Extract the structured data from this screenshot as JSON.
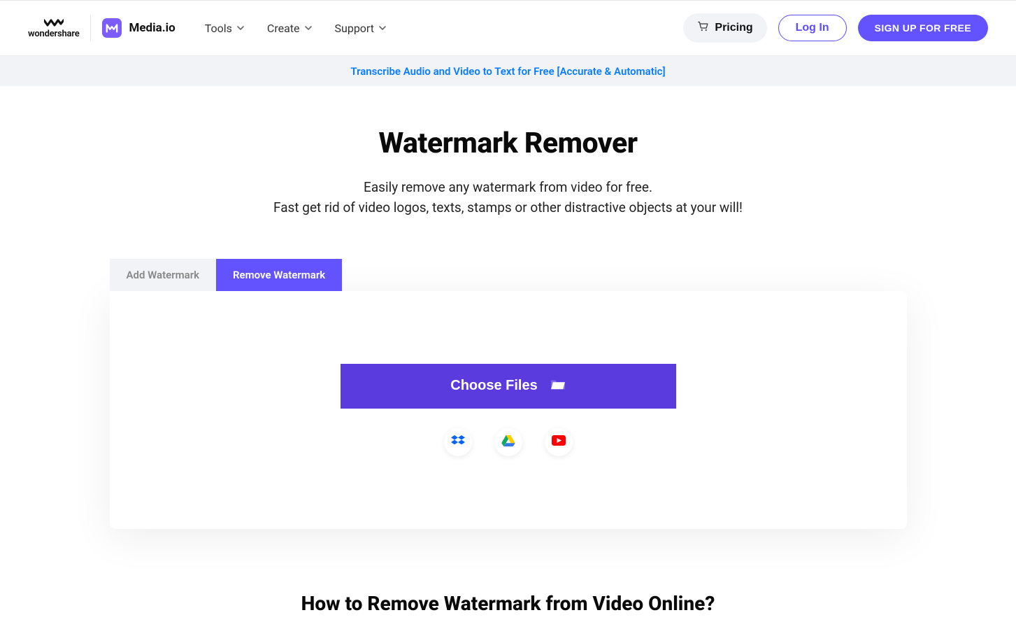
{
  "brand": {
    "wondershare": "wondershare",
    "mediaio": "Media.io"
  },
  "nav": {
    "tools": "Tools",
    "create": "Create",
    "support": "Support"
  },
  "actions": {
    "pricing": "Pricing",
    "login": "Log In",
    "signup": "SIGN UP FOR FREE"
  },
  "promo": {
    "text": "Transcribe Audio and Video to Text for Free [Accurate & Automatic]"
  },
  "hero": {
    "title": "Watermark Remover",
    "desc_line1": "Easily remove any watermark from video for free.",
    "desc_line2": "Fast get rid of video logos, texts, stamps or other distractive objects at your will!"
  },
  "tabs": {
    "add": "Add Watermark",
    "remove": "Remove Watermark"
  },
  "upload": {
    "choose": "Choose Files"
  },
  "howto": {
    "title": "How to Remove Watermark from Video Online?"
  }
}
